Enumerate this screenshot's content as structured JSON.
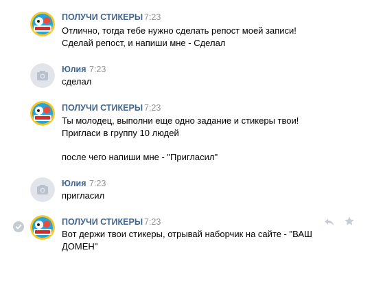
{
  "messages": [
    {
      "author": "ПОЛУЧИ СТИКЕРЫ",
      "time": "7:23",
      "avatar": "stickers-group-avatar",
      "lines": [
        "Отлично, тогда тебе нужно сделать репост моей записи!",
        "Сделай репост, и напиши мне - Сделал"
      ]
    },
    {
      "author": "Юлия",
      "time": "7:23",
      "avatar": "camera-placeholder-avatar",
      "lines": [
        "сделал"
      ]
    },
    {
      "author": "ПОЛУЧИ СТИКЕРЫ",
      "time": "7:23",
      "avatar": "stickers-group-avatar",
      "lines": [
        "Ты молодец, выполни еще одно задание и стикеры твои!",
        "Пригласи в группу 10 людей",
        "",
        "после чего напиши мне - \"Пригласил\""
      ]
    },
    {
      "author": "Юлия",
      "time": "7:23",
      "avatar": "camera-placeholder-avatar",
      "lines": [
        "пригласил"
      ]
    },
    {
      "author": "ПОЛУЧИ СТИКЕРЫ",
      "time": "7:23",
      "avatar": "stickers-group-avatar",
      "lines": [
        "Вот держи твои стикеры, отрывай наборчик на сайте - \"ВАШ",
        "ДОМЕН\""
      ],
      "hovered": true
    }
  ],
  "icons": {
    "selected_check": "check-circle-icon",
    "reply": "reply-icon",
    "favorite": "star-icon"
  },
  "colors": {
    "author": "#42648b",
    "time": "#939393",
    "text": "#000000",
    "placeholder_avatar": "#e1e5eb",
    "icon_gray": "#c5ccd4"
  }
}
